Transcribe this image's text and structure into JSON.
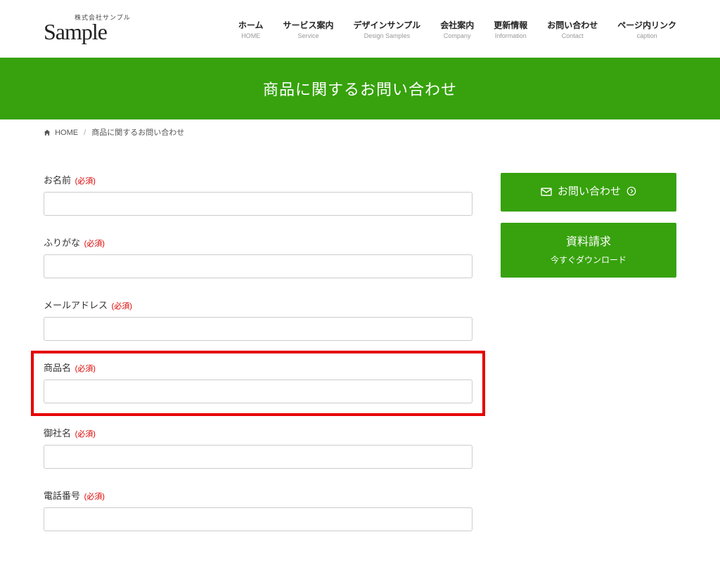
{
  "logo": {
    "sup": "株式会社サンプル",
    "main": "Sample"
  },
  "nav": [
    {
      "ja": "ホーム",
      "en": "HOME"
    },
    {
      "ja": "サービス案内",
      "en": "Service"
    },
    {
      "ja": "デザインサンプル",
      "en": "Design Samples"
    },
    {
      "ja": "会社案内",
      "en": "Company"
    },
    {
      "ja": "更新情報",
      "en": "Information"
    },
    {
      "ja": "お問い合わせ",
      "en": "Contact"
    },
    {
      "ja": "ページ内リンク",
      "en": "caption"
    }
  ],
  "banner": {
    "title": "商品に関するお問い合わせ"
  },
  "breadcrumb": {
    "home": "HOME",
    "current": "商品に関するお問い合わせ"
  },
  "form": {
    "required_text": "(必須)",
    "fields": {
      "name": {
        "label": "お名前"
      },
      "kana": {
        "label": "ふりがな"
      },
      "email": {
        "label": "メールアドレス"
      },
      "product": {
        "label": "商品名"
      },
      "company": {
        "label": "御社名"
      },
      "tel": {
        "label": "電話番号"
      }
    }
  },
  "side": {
    "contact": {
      "label": "お問い合わせ"
    },
    "download": {
      "line1": "資料請求",
      "line2": "今すぐダウンロード"
    }
  }
}
